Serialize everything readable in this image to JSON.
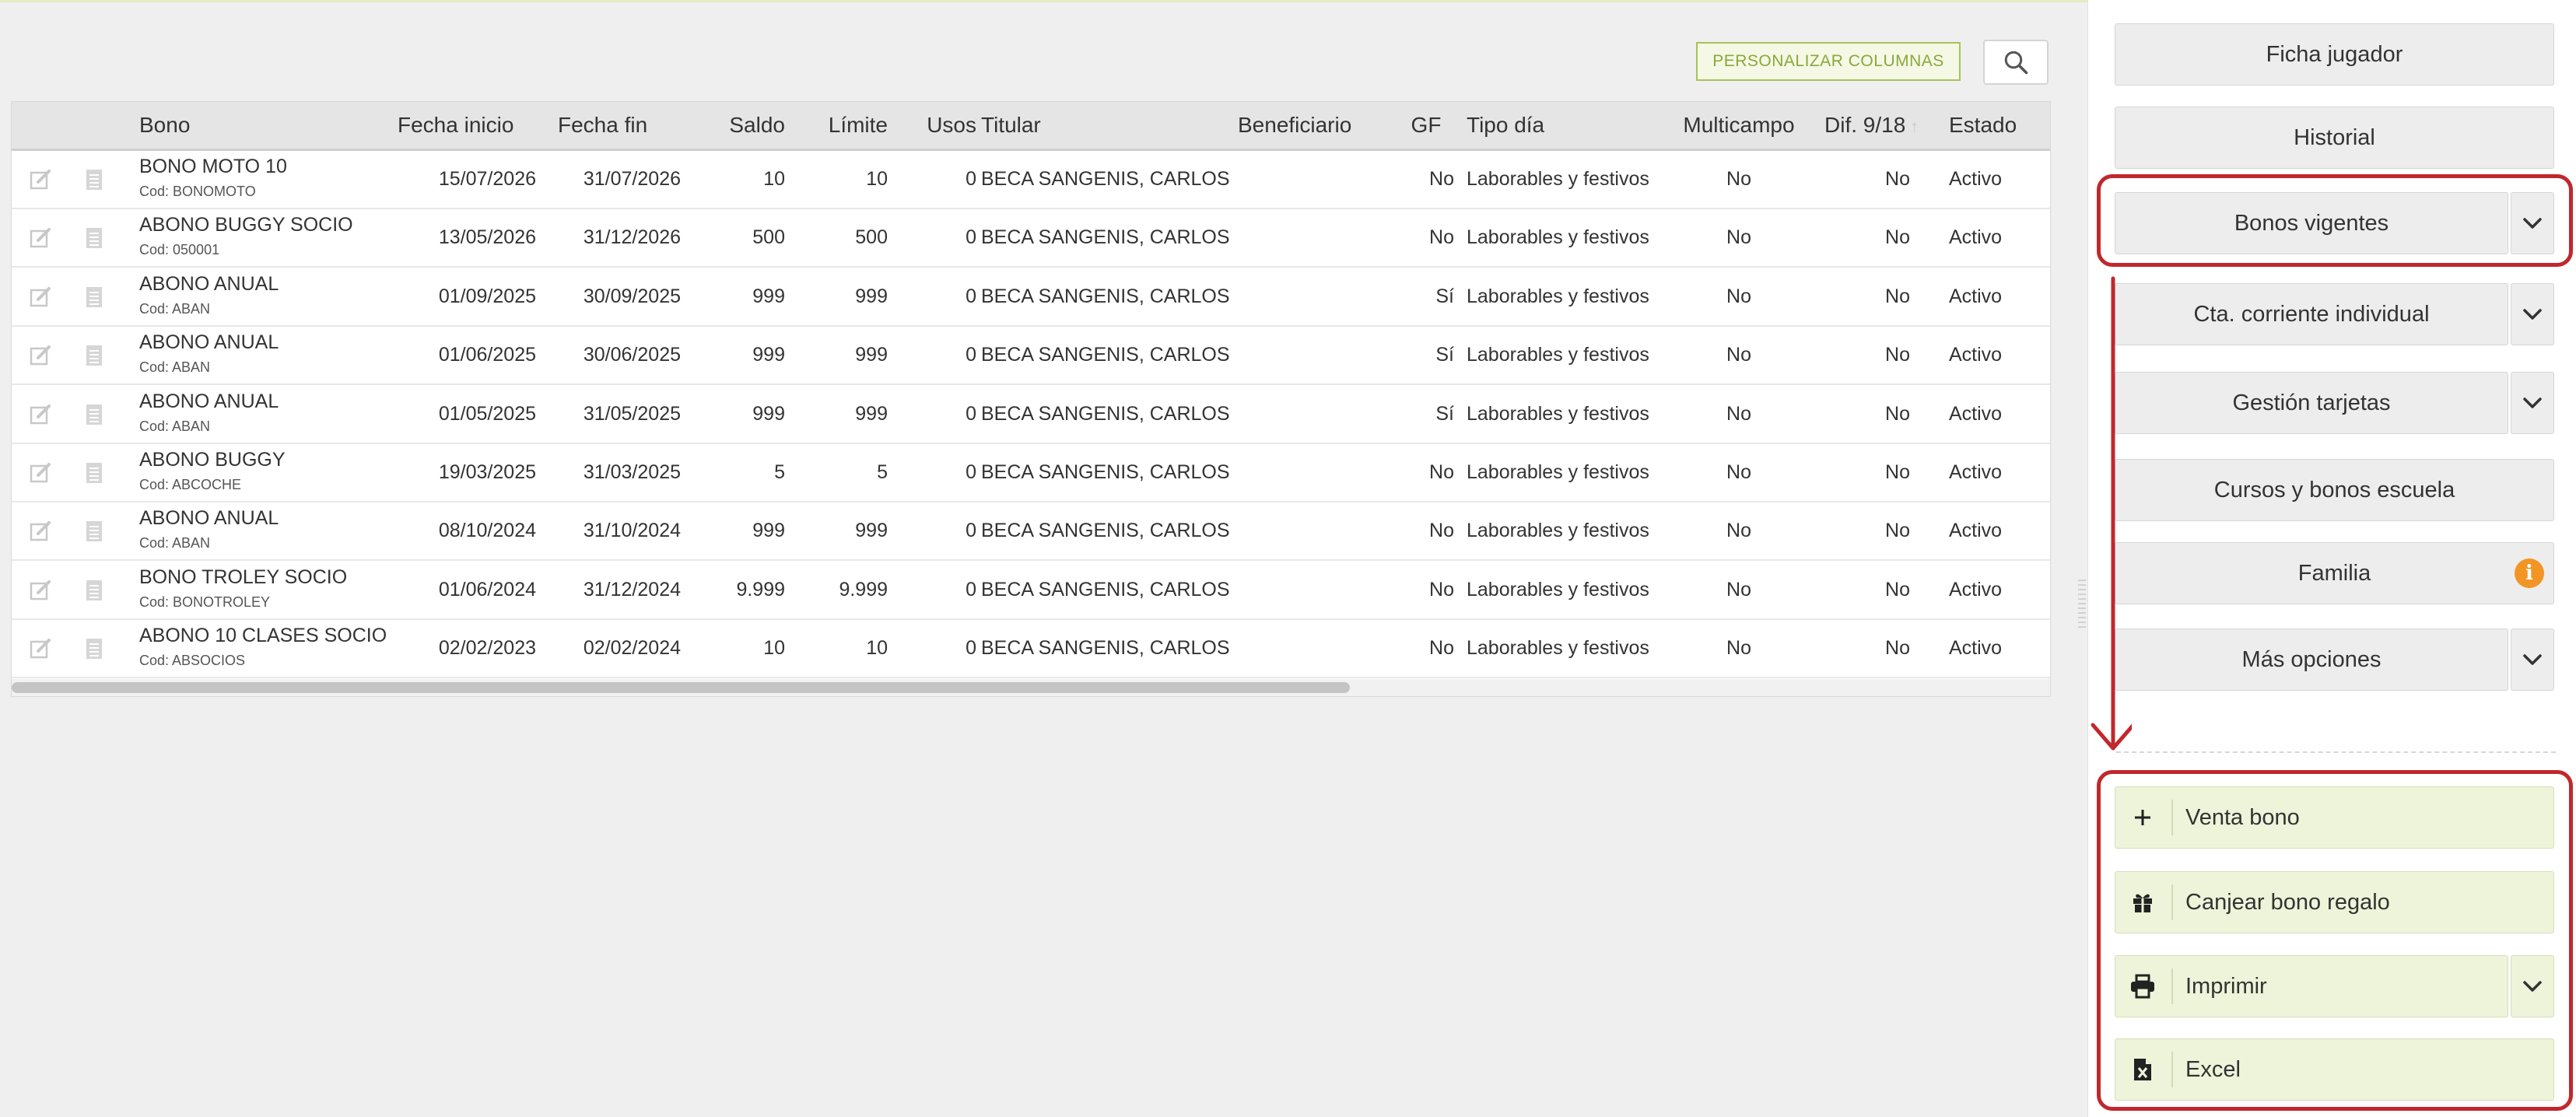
{
  "toolbar": {
    "customize_columns_label": "PERSONALIZAR COLUMNAS",
    "search_icon": "search-icon"
  },
  "table": {
    "columns": {
      "bono": "Bono",
      "fecha_inicio": "Fecha inicio",
      "fecha_fin": "Fecha fin",
      "saldo": "Saldo",
      "limite": "Límite",
      "usos": "Usos",
      "titular": "Titular",
      "beneficiario": "Beneficiario",
      "gf": "GF",
      "tipo_dia": "Tipo día",
      "multicampo": "Multicampo",
      "dif": "Dif. 9/18",
      "estado": "Estado"
    },
    "rows": [
      {
        "bono": "BONO MOTO 10",
        "cod": "Cod: BONOMOTO",
        "fecha_inicio": "15/07/2026",
        "fecha_fin": "31/07/2026",
        "saldo": "10",
        "limite": "10",
        "usos": "0",
        "titular": "BECA SANGENIS, CARLOS",
        "beneficiario": "",
        "gf": "No",
        "tipo_dia": "Laborables y festivos",
        "multicampo": "No",
        "dif": "No",
        "estado": "Activo"
      },
      {
        "bono": "ABONO BUGGY SOCIO",
        "cod": "Cod: 050001",
        "fecha_inicio": "13/05/2026",
        "fecha_fin": "31/12/2026",
        "saldo": "500",
        "limite": "500",
        "usos": "0",
        "titular": "BECA SANGENIS, CARLOS",
        "beneficiario": "",
        "gf": "No",
        "tipo_dia": "Laborables y festivos",
        "multicampo": "No",
        "dif": "No",
        "estado": "Activo"
      },
      {
        "bono": "ABONO ANUAL",
        "cod": "Cod: ABAN",
        "fecha_inicio": "01/09/2025",
        "fecha_fin": "30/09/2025",
        "saldo": "999",
        "limite": "999",
        "usos": "0",
        "titular": "BECA SANGENIS, CARLOS",
        "beneficiario": "",
        "gf": "Sí",
        "tipo_dia": "Laborables y festivos",
        "multicampo": "No",
        "dif": "No",
        "estado": "Activo"
      },
      {
        "bono": "ABONO ANUAL",
        "cod": "Cod: ABAN",
        "fecha_inicio": "01/06/2025",
        "fecha_fin": "30/06/2025",
        "saldo": "999",
        "limite": "999",
        "usos": "0",
        "titular": "BECA SANGENIS, CARLOS",
        "beneficiario": "",
        "gf": "Sí",
        "tipo_dia": "Laborables y festivos",
        "multicampo": "No",
        "dif": "No",
        "estado": "Activo"
      },
      {
        "bono": "ABONO ANUAL",
        "cod": "Cod: ABAN",
        "fecha_inicio": "01/05/2025",
        "fecha_fin": "31/05/2025",
        "saldo": "999",
        "limite": "999",
        "usos": "0",
        "titular": "BECA SANGENIS, CARLOS",
        "beneficiario": "",
        "gf": "Sí",
        "tipo_dia": "Laborables y festivos",
        "multicampo": "No",
        "dif": "No",
        "estado": "Activo"
      },
      {
        "bono": "ABONO BUGGY",
        "cod": "Cod: ABCOCHE",
        "fecha_inicio": "19/03/2025",
        "fecha_fin": "31/03/2025",
        "saldo": "5",
        "limite": "5",
        "usos": "0",
        "titular": "BECA SANGENIS, CARLOS",
        "beneficiario": "",
        "gf": "No",
        "tipo_dia": "Laborables y festivos",
        "multicampo": "No",
        "dif": "No",
        "estado": "Activo"
      },
      {
        "bono": "ABONO ANUAL",
        "cod": "Cod: ABAN",
        "fecha_inicio": "08/10/2024",
        "fecha_fin": "31/10/2024",
        "saldo": "999",
        "limite": "999",
        "usos": "0",
        "titular": "BECA SANGENIS, CARLOS",
        "beneficiario": "",
        "gf": "No",
        "tipo_dia": "Laborables y festivos",
        "multicampo": "No",
        "dif": "No",
        "estado": "Activo"
      },
      {
        "bono": "BONO TROLEY SOCIO",
        "cod": "Cod: BONOTROLEY",
        "fecha_inicio": "01/06/2024",
        "fecha_fin": "31/12/2024",
        "saldo": "9.999",
        "limite": "9.999",
        "usos": "0",
        "titular": "BECA SANGENIS, CARLOS",
        "beneficiario": "",
        "gf": "No",
        "tipo_dia": "Laborables y festivos",
        "multicampo": "No",
        "dif": "No",
        "estado": "Activo"
      },
      {
        "bono": "ABONO 10 CLASES SOCIO",
        "cod": "Cod: ABSOCIOS",
        "fecha_inicio": "02/02/2023",
        "fecha_fin": "02/02/2024",
        "saldo": "10",
        "limite": "10",
        "usos": "0",
        "titular": "BECA SANGENIS, CARLOS",
        "beneficiario": "",
        "gf": "No",
        "tipo_dia": "Laborables y festivos",
        "multicampo": "No",
        "dif": "No",
        "estado": "Activo"
      }
    ]
  },
  "panel": {
    "ficha_jugador": "Ficha jugador",
    "historial": "Historial",
    "bonos_vigentes": "Bonos vigentes",
    "cta_corriente": "Cta. corriente individual",
    "gestion_tarjetas": "Gestión tarjetas",
    "cursos_bonos": "Cursos y bonos escuela",
    "familia": "Familia",
    "familia_badge": "i",
    "mas_opciones": "Más opciones"
  },
  "actions": {
    "venta_bono": "Venta bono",
    "canjear_bono": "Canjear bono regalo",
    "imprimir": "Imprimir",
    "excel": "Excel"
  },
  "colors": {
    "accent_green": "#a8c25a",
    "action_bg": "#eef4da",
    "highlight_red": "#c0282d",
    "info_orange": "#f29524"
  }
}
